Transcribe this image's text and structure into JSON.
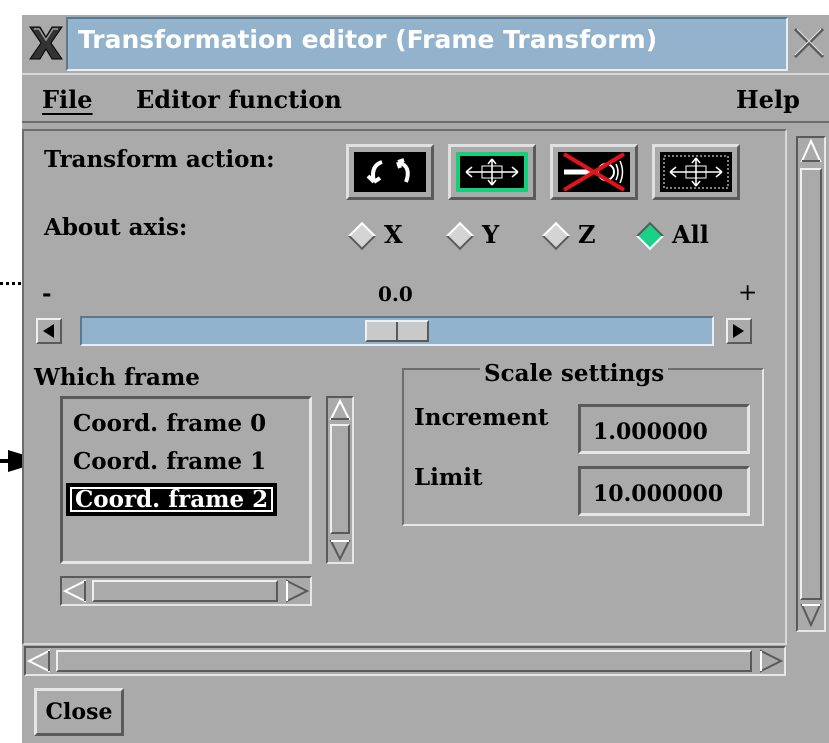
{
  "window": {
    "title": "Transformation editor (Frame Transform)"
  },
  "menubar": {
    "file": "File",
    "editor_function": "Editor function",
    "help": "Help"
  },
  "transform_action": {
    "label": "Transform action:",
    "buttons": [
      {
        "name": "rotate",
        "icon": "rotate-arrows-icon",
        "active": false
      },
      {
        "name": "translate",
        "icon": "translate-arrows-icon",
        "active": true
      },
      {
        "name": "scale-disabled",
        "icon": "no-scale-icon",
        "active": false
      },
      {
        "name": "resize",
        "icon": "resize-arrows-icon",
        "active": false
      }
    ]
  },
  "about_axis": {
    "label": "About axis:",
    "options": [
      "X",
      "Y",
      "Z",
      "All"
    ],
    "selected": "All"
  },
  "slider": {
    "minus": "-",
    "plus": "+",
    "value": "0.0",
    "position": 0.5
  },
  "which_frame": {
    "label": "Which frame",
    "items": [
      "Coord. frame 0",
      "Coord. frame 1",
      "Coord. frame 2"
    ],
    "selected_index": 2
  },
  "scale_settings": {
    "title": "Scale settings",
    "increment_label": "Increment",
    "increment_value": "1.000000",
    "limit_label": "Limit",
    "limit_value": "10.000000"
  },
  "close_button": "Close",
  "colors": {
    "window_bg": "#aaaaaa",
    "title_bar": "#93b3cc",
    "active_green": "#14d07a"
  }
}
